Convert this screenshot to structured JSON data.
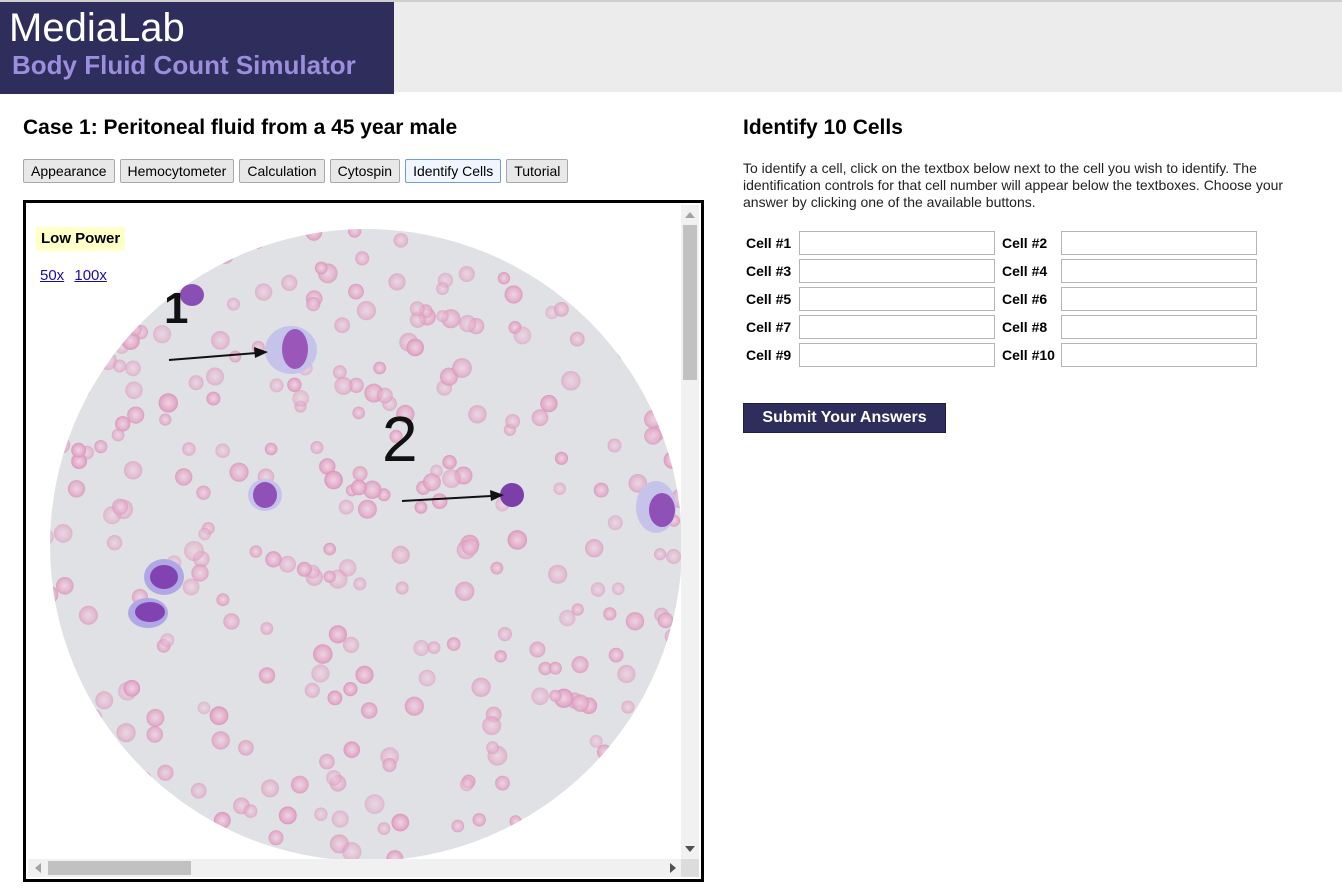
{
  "header": {
    "app_name": "MediaLab",
    "subtitle": "Body Fluid Count Simulator",
    "brand_color": "#2e2d5c",
    "subtitle_color": "#9b8fdc"
  },
  "case": {
    "title": "Case 1: Peritoneal fluid from a 45 year male"
  },
  "tabs": [
    {
      "label": "Appearance",
      "active": false
    },
    {
      "label": "Hemocytometer",
      "active": false
    },
    {
      "label": "Calculation",
      "active": false
    },
    {
      "label": "Cytospin",
      "active": false
    },
    {
      "label": "Identify Cells",
      "active": true
    },
    {
      "label": "Tutorial",
      "active": false
    }
  ],
  "viewer": {
    "power_label": "Low Power",
    "zoom_links": [
      "50x",
      "100x"
    ],
    "image_markers": [
      "1",
      "2"
    ]
  },
  "identify": {
    "title": "Identify 10 Cells",
    "instructions": "To identify a cell, click on the textbox below next to the cell you wish to identify. The identification controls for that cell number will appear below the textboxes. Choose your answer by clicking one of the available buttons.",
    "cells": [
      {
        "label": "Cell #1",
        "value": ""
      },
      {
        "label": "Cell #2",
        "value": ""
      },
      {
        "label": "Cell #3",
        "value": ""
      },
      {
        "label": "Cell #4",
        "value": ""
      },
      {
        "label": "Cell #5",
        "value": ""
      },
      {
        "label": "Cell #6",
        "value": ""
      },
      {
        "label": "Cell #7",
        "value": ""
      },
      {
        "label": "Cell #8",
        "value": ""
      },
      {
        "label": "Cell #9",
        "value": ""
      },
      {
        "label": "Cell #10",
        "value": ""
      }
    ],
    "submit_label": "Submit Your Answers"
  }
}
